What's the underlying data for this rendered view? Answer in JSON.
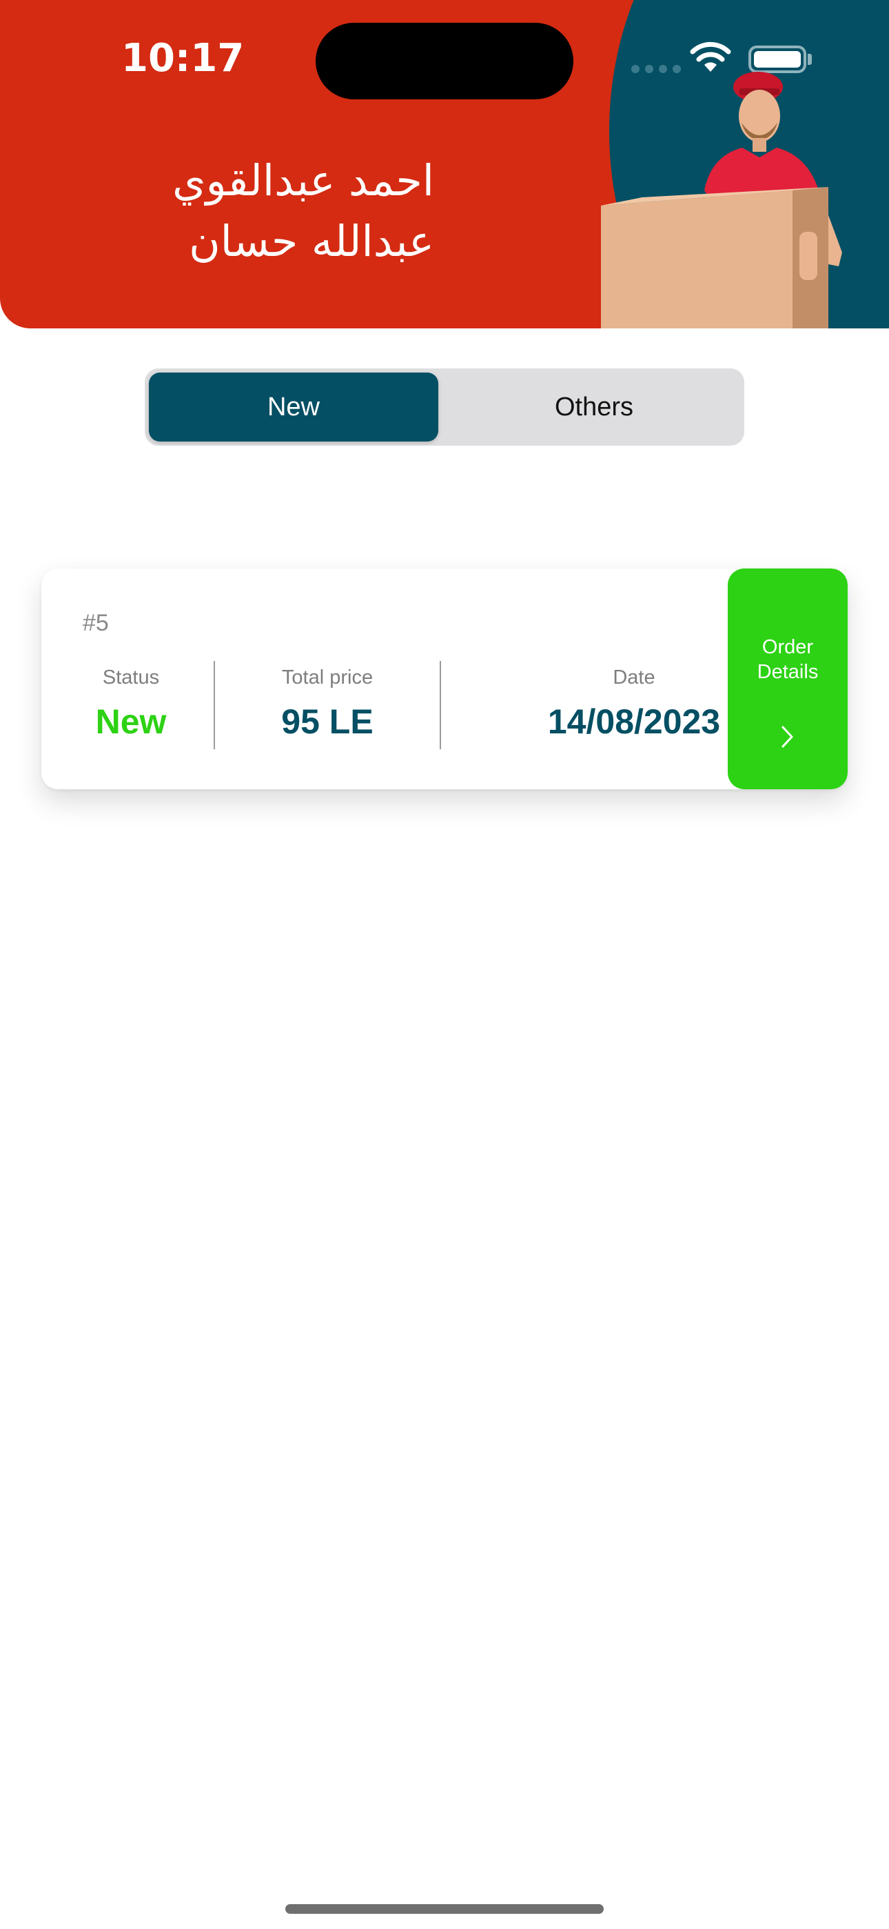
{
  "status_bar": {
    "time": "10:17",
    "icons": [
      "cellular-signal-icon",
      "wifi-icon",
      "battery-icon"
    ]
  },
  "header": {
    "driver_name": "احمد عبدالقوي\nعبدالله حسان",
    "illustration": "delivery-courier-with-box",
    "colors": {
      "primary": "#d42b12",
      "accent": "#044f63"
    }
  },
  "tabs": {
    "items": [
      {
        "label": "New",
        "selected": true
      },
      {
        "label": "Others",
        "selected": false
      }
    ]
  },
  "orders": [
    {
      "id": "#5",
      "status_label": "Status",
      "status": "New",
      "price_label": "Total price",
      "price": "95 LE",
      "date_label": "Date",
      "date": "14/08/2023",
      "details_label": "Order\nDetails",
      "details_icon": "chevron-right-icon"
    }
  ],
  "colors": {
    "status_new": "#2dd214",
    "details_button": "#2dd214",
    "value_text": "#044f63"
  }
}
